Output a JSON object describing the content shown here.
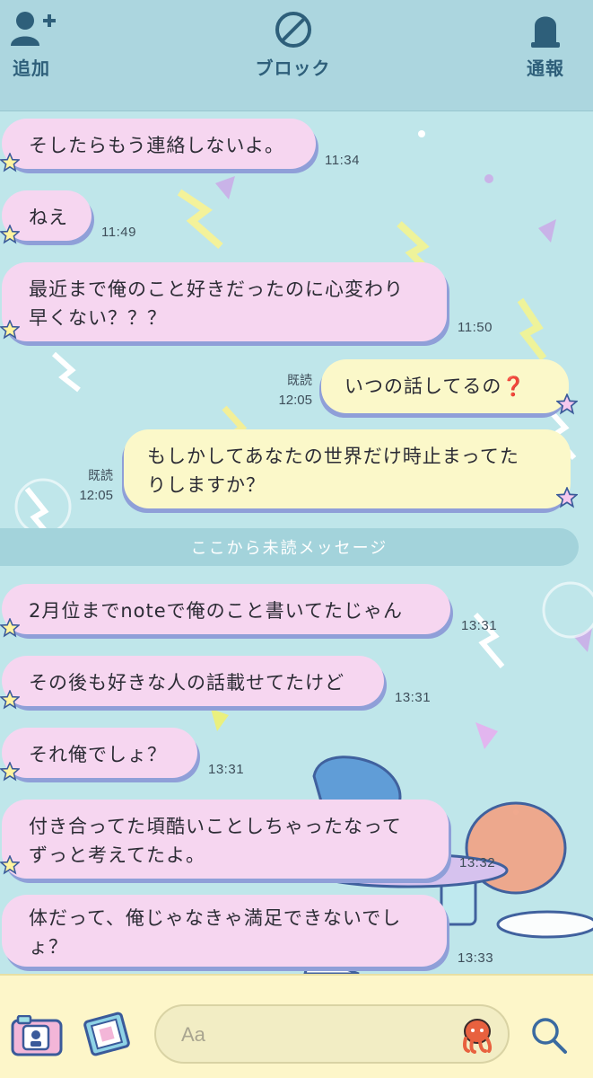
{
  "header": {
    "add_label": "追加",
    "block_label": "ブロック",
    "report_label": "通報"
  },
  "messages": [
    {
      "dir": "in",
      "text": "そしたらもう連絡しないよ。",
      "time": "11:34"
    },
    {
      "dir": "in",
      "text": "ねえ",
      "time": "11:49"
    },
    {
      "dir": "in",
      "line1": "最近まで俺のこと好きだったのに心変わり",
      "line2": "早くない？？？",
      "time": "11:50"
    },
    {
      "dir": "out",
      "text": "いつの話してるの",
      "emoji": "❓",
      "read": "既読",
      "time": "12:05"
    },
    {
      "dir": "out",
      "line1": "もしかしてあなたの世界だけ時止まってた",
      "line2": "りしますか？",
      "read": "既読",
      "time": "12:05"
    },
    {
      "dir": "in",
      "text": "2月位までnoteで俺のこと書いてたじゃん",
      "time": "13:31"
    },
    {
      "dir": "in",
      "text": "その後も好きな人の話載せてたけど",
      "time": "13:31"
    },
    {
      "dir": "in",
      "text": "それ俺でしょ？",
      "time": "13:31"
    },
    {
      "dir": "in",
      "line1": "付き合ってた頃酷いことしちゃったなって",
      "line2": "ずっと考えてたよ。",
      "time": "13:32"
    },
    {
      "dir": "in",
      "line1": "体だって、俺じゃなきゃ満足できないでし",
      "line2": "ょ？",
      "time": "13:33"
    }
  ],
  "divider": {
    "label": "ここから未読メッセージ"
  },
  "composer": {
    "placeholder": "Aa",
    "icons": [
      "camera-icon",
      "photo-album-icon",
      "octopus-sticker-icon",
      "search-icon"
    ]
  },
  "colors": {
    "incoming_bubble": "#f6d6f0",
    "outgoing_bubble": "#fbf8c9",
    "header_bg": "#acd6df",
    "chat_bg": "#bfe6ea",
    "composer_bg": "#fdf6c9",
    "accent_text": "#2e5f7a"
  }
}
